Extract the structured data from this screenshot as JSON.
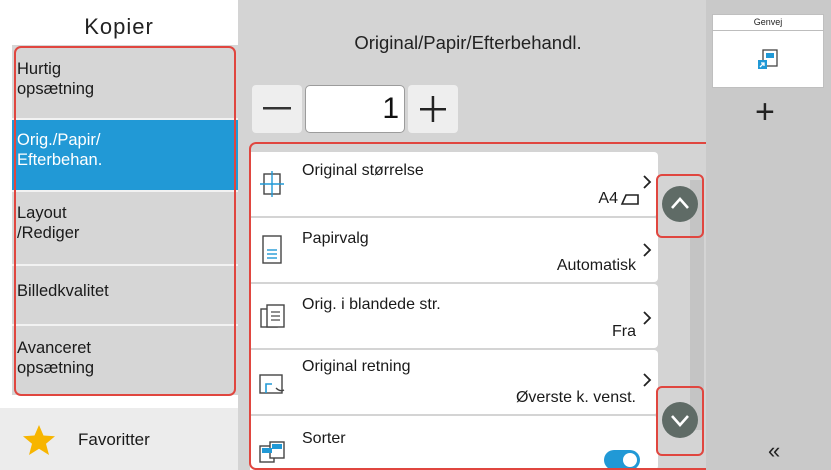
{
  "left_panel": {
    "title": "Kopier",
    "nav": [
      {
        "label": "Hurtig\nopsætning",
        "active": false
      },
      {
        "label": "Orig./Papir/\nEfterbehan.",
        "active": true
      },
      {
        "label": "Layout\n/Rediger",
        "active": false
      },
      {
        "label": "Billedkvalitet",
        "active": false
      },
      {
        "label": "Avanceret\nopsætning",
        "active": false
      }
    ],
    "favorites_label": "Favoritter"
  },
  "main": {
    "title": "Original/Papir/Efterbehandl.",
    "copies": "1",
    "minus_symbol": "—",
    "plus_symbol": "+",
    "rows": [
      {
        "label": "Original størrelse",
        "value": "A4",
        "icon": "original-size-icon"
      },
      {
        "label": "Papirvalg",
        "value": "Automatisk",
        "icon": "paper-tray-icon"
      },
      {
        "label": "Orig. i blandede str.",
        "value": "Fra",
        "icon": "mixed-size-icon"
      },
      {
        "label": "Original retning",
        "value": "Øverste k. venst.",
        "icon": "orientation-icon"
      },
      {
        "label": "Sorter",
        "value": "",
        "icon": "collate-icon",
        "toggle_on": true
      }
    ]
  },
  "right_panel": {
    "shortcut_label": "Genvej",
    "add_symbol": "+",
    "collapse_symbol": "«"
  },
  "colors": {
    "accent": "#2199d6",
    "highlight_outline": "#e0463f",
    "scroll_button": "#5f6b66",
    "star": "#f7b500"
  }
}
